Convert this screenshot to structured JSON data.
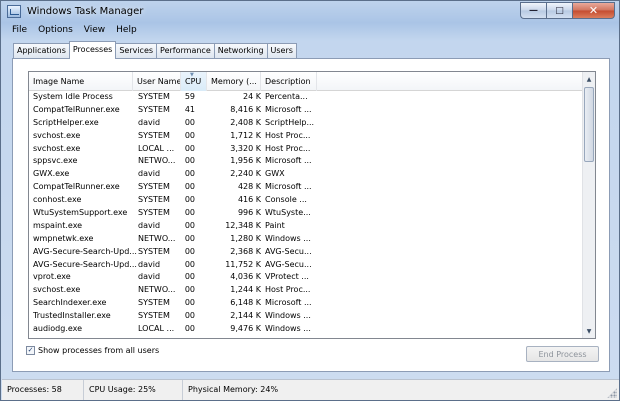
{
  "window": {
    "title": "Windows Task Manager",
    "caption_buttons": {
      "minimize": "—",
      "maximize": "□",
      "close": "✕"
    }
  },
  "menu": [
    "File",
    "Options",
    "View",
    "Help"
  ],
  "tabs": [
    "Applications",
    "Processes",
    "Services",
    "Performance",
    "Networking",
    "Users"
  ],
  "active_tab": "Processes",
  "columns": [
    "Image Name",
    "User Name",
    "CPU",
    "Memory (...",
    "Description"
  ],
  "sorted_column": "CPU",
  "processes": [
    {
      "name": "System Idle Process",
      "user": "SYSTEM",
      "cpu": "59",
      "mem": "24 K",
      "desc": "Percenta..."
    },
    {
      "name": "CompatTelRunner.exe",
      "user": "SYSTEM",
      "cpu": "41",
      "mem": "8,416 K",
      "desc": "Microsoft ..."
    },
    {
      "name": "ScriptHelper.exe",
      "user": "david",
      "cpu": "00",
      "mem": "2,408 K",
      "desc": "ScriptHelp..."
    },
    {
      "name": "svchost.exe",
      "user": "SYSTEM",
      "cpu": "00",
      "mem": "1,712 K",
      "desc": "Host Proc..."
    },
    {
      "name": "svchost.exe",
      "user": "LOCAL ...",
      "cpu": "00",
      "mem": "3,320 K",
      "desc": "Host Proc..."
    },
    {
      "name": "sppsvc.exe",
      "user": "NETWO...",
      "cpu": "00",
      "mem": "1,956 K",
      "desc": "Microsoft ..."
    },
    {
      "name": "GWX.exe",
      "user": "david",
      "cpu": "00",
      "mem": "2,240 K",
      "desc": "GWX"
    },
    {
      "name": "CompatTelRunner.exe",
      "user": "SYSTEM",
      "cpu": "00",
      "mem": "428 K",
      "desc": "Microsoft ..."
    },
    {
      "name": "conhost.exe",
      "user": "SYSTEM",
      "cpu": "00",
      "mem": "416 K",
      "desc": "Console ..."
    },
    {
      "name": "WtuSystemSupport.exe",
      "user": "SYSTEM",
      "cpu": "00",
      "mem": "996 K",
      "desc": "WtuSyste..."
    },
    {
      "name": "mspaint.exe",
      "user": "david",
      "cpu": "00",
      "mem": "12,348 K",
      "desc": "Paint"
    },
    {
      "name": "wmpnetwk.exe",
      "user": "NETWO...",
      "cpu": "00",
      "mem": "1,280 K",
      "desc": "Windows ..."
    },
    {
      "name": "AVG-Secure-Search-Upd...",
      "user": "SYSTEM",
      "cpu": "00",
      "mem": "2,368 K",
      "desc": "AVG-Secu..."
    },
    {
      "name": "AVG-Secure-Search-Upd...",
      "user": "david",
      "cpu": "00",
      "mem": "11,752 K",
      "desc": "AVG-Secu..."
    },
    {
      "name": "vprot.exe",
      "user": "david",
      "cpu": "00",
      "mem": "4,036 K",
      "desc": "VProtect ..."
    },
    {
      "name": "svchost.exe",
      "user": "NETWO...",
      "cpu": "00",
      "mem": "1,244 K",
      "desc": "Host Proc..."
    },
    {
      "name": "SearchIndexer.exe",
      "user": "SYSTEM",
      "cpu": "00",
      "mem": "6,148 K",
      "desc": "Microsoft ..."
    },
    {
      "name": "TrustedInstaller.exe",
      "user": "SYSTEM",
      "cpu": "00",
      "mem": "2,144 K",
      "desc": "Windows ..."
    },
    {
      "name": "audiodg.exe",
      "user": "LOCAL ...",
      "cpu": "00",
      "mem": "9,476 K",
      "desc": "Windows ..."
    }
  ],
  "show_all_processes": {
    "label": "Show processes from all users",
    "checked": true,
    "check_glyph": "✓"
  },
  "end_process_button": "End Process",
  "status": {
    "processes": "Processes: 58",
    "cpu_usage": "CPU Usage: 25%",
    "physical_memory": "Physical Memory: 24%"
  },
  "scrollbar": {
    "up": "▲",
    "down": "▼"
  },
  "colors": {
    "title_gradient_top": "#bed3ec",
    "close_button": "#c44b2f",
    "sorted_header": "#d9ebf8"
  }
}
